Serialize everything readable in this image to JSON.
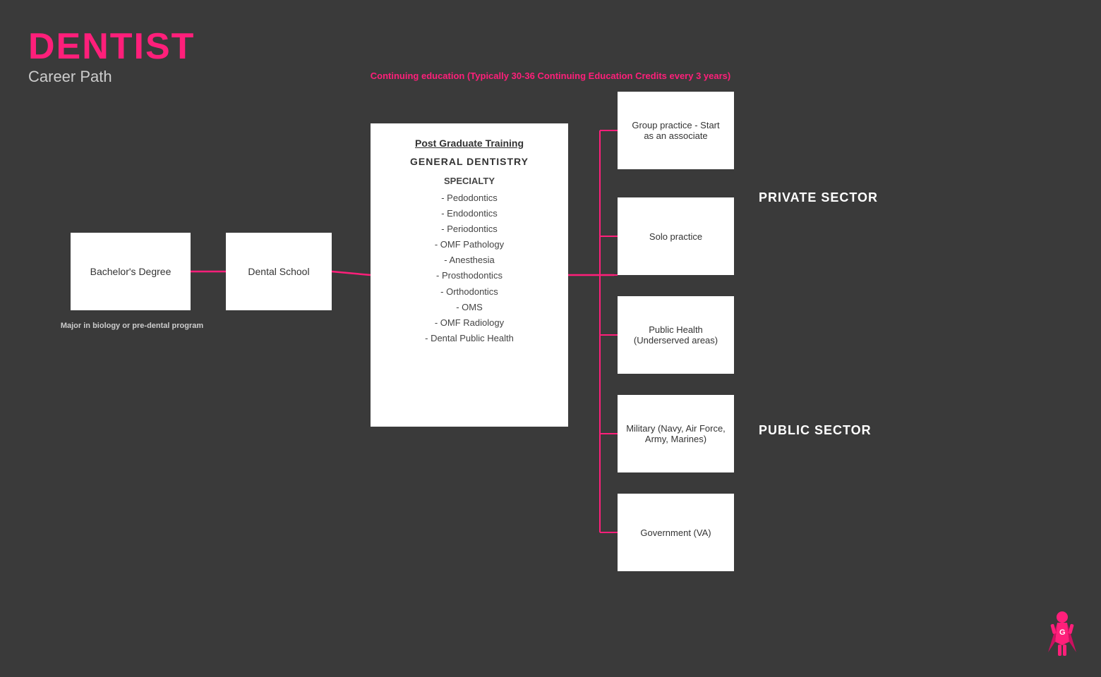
{
  "title": {
    "main": "DENTIST",
    "sub": "Career Path"
  },
  "cont_ed": "Continuing education (Typically 30-36 Continuing Education Credits every 3 years)",
  "boxes": {
    "bachelor": "Bachelor's Degree",
    "dental": "Dental School",
    "postgrad": {
      "title": "Post Graduate Training",
      "general": "GENERAL DENTISTRY",
      "specialty_title": "SPECIALTY",
      "items": [
        "- Pedodontics",
        "- Endodontics",
        "- Periodontics",
        "- OMF Pathology",
        "- Anesthesia",
        "- Prosthodontics",
        "- Orthodontics",
        "- OMS",
        "- OMF Radiology",
        "- Dental Public Health"
      ]
    },
    "group": "Group practice - Start as an associate",
    "solo": "Solo practice",
    "publichealth": "Public Health (Underserved areas)",
    "military": "Military (Navy, Air Force, Army, Marines)",
    "govt": "Government (VA)"
  },
  "sectors": {
    "private": "PRIVATE SECTOR",
    "public": "PUBLIC SECTOR"
  },
  "bachelor_note": "Major in biology or\npre-dental program",
  "accent_color": "#ff1f7a"
}
